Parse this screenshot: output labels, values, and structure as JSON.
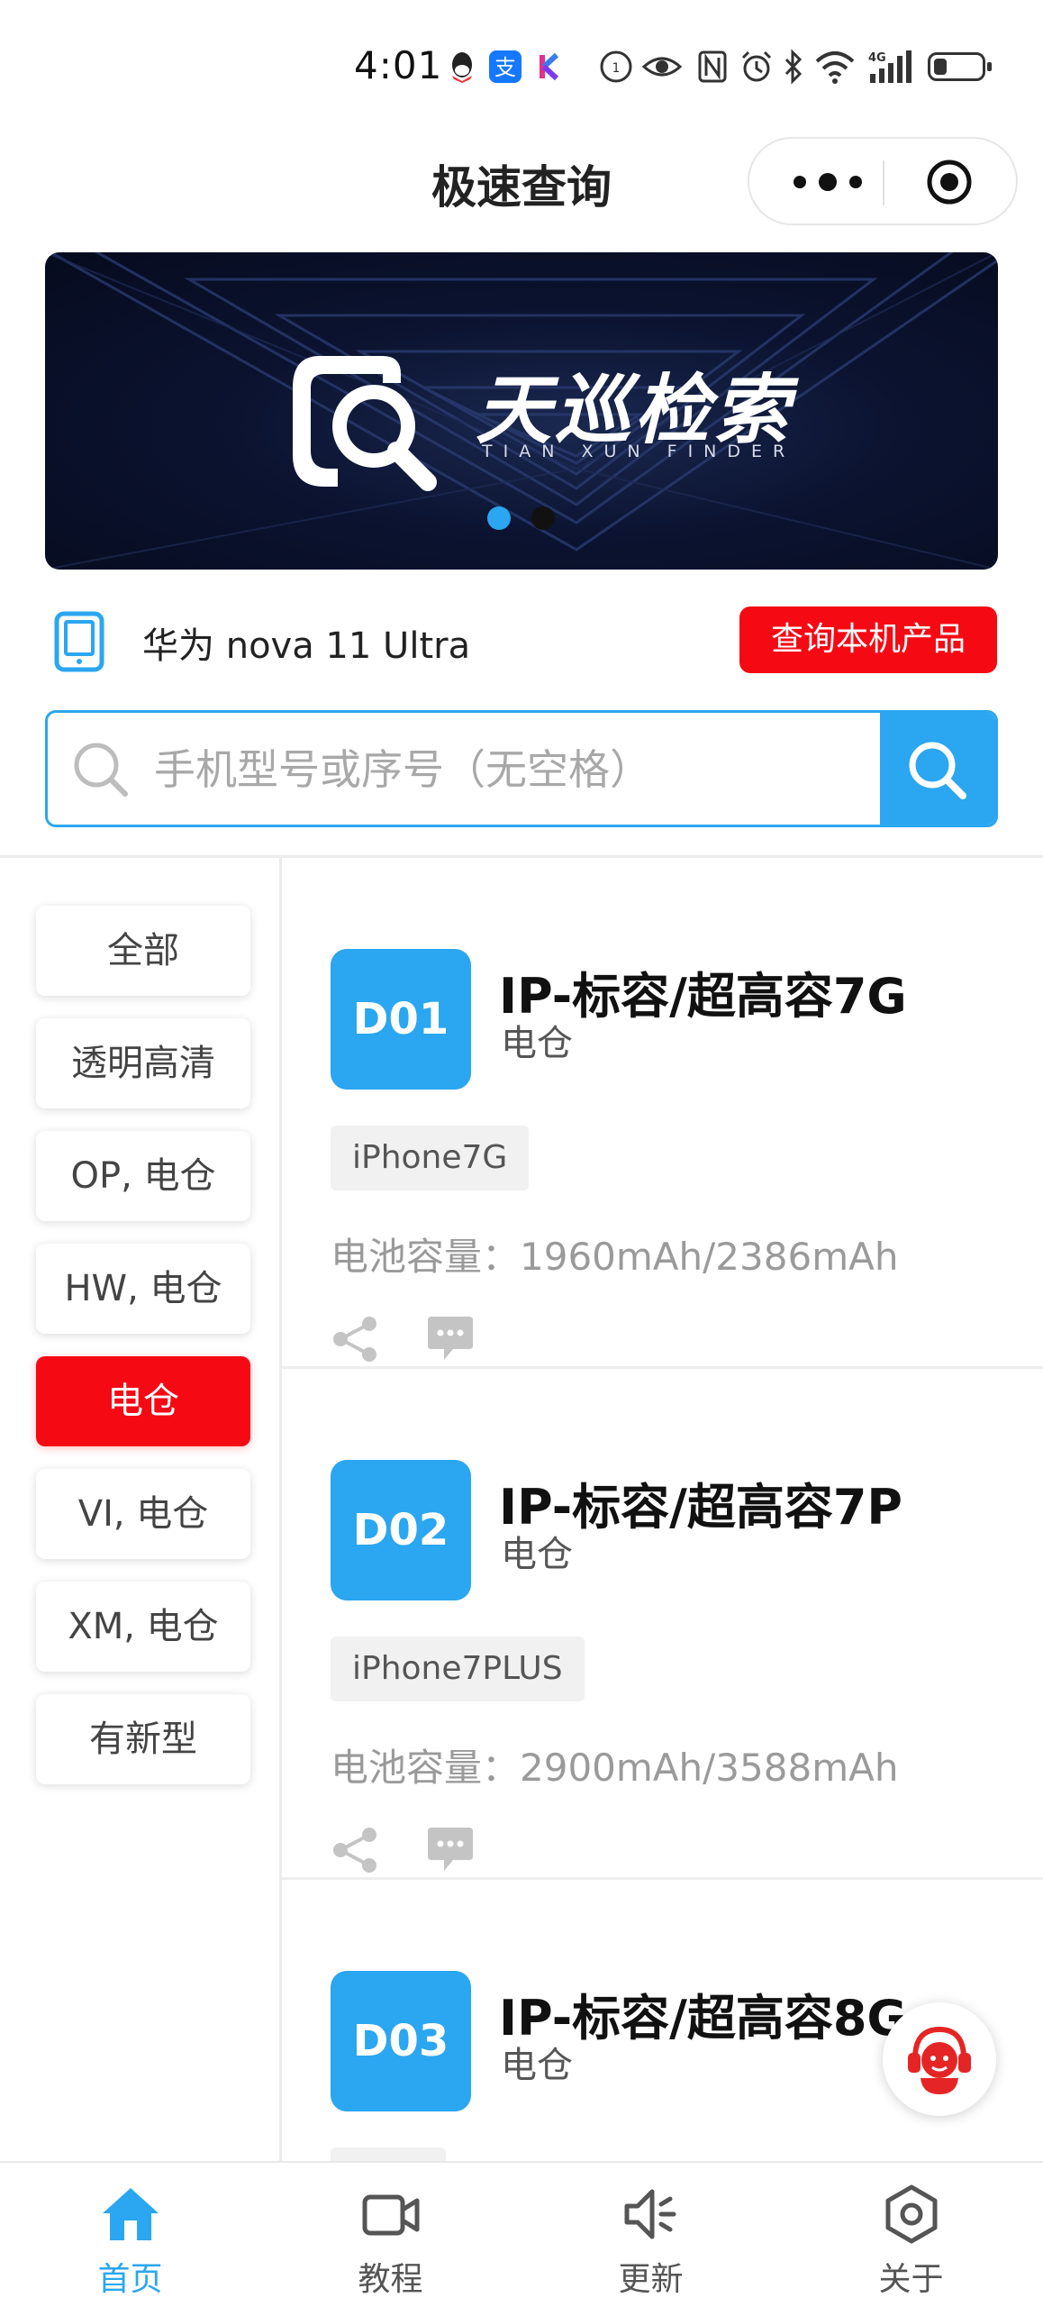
{
  "status_bar": {
    "time": "4:01",
    "network": "4G"
  },
  "header": {
    "title": "极速查询",
    "menu_icon": "more-dots-icon",
    "close_icon": "target-circle-icon"
  },
  "banner": {
    "title": "天巡检索",
    "subtitle": "TIAN XUN FINDER",
    "active_dot": 0,
    "dot_count": 2,
    "dot_colors": [
      "#2ba6f0",
      "#111111"
    ]
  },
  "device": {
    "name": "华为 nova 11 Ultra",
    "query_label": "查询本机产品"
  },
  "search": {
    "placeholder": "手机型号或序号（无空格）",
    "value": ""
  },
  "categories": [
    {
      "label": "全部",
      "active": false
    },
    {
      "label": "透明高清",
      "active": false
    },
    {
      "label": "OP, 电仓",
      "active": false
    },
    {
      "label": "HW, 电仓",
      "active": false
    },
    {
      "label": "电仓",
      "active": true
    },
    {
      "label": "VI, 电仓",
      "active": false
    },
    {
      "label": "XM, 电仓",
      "active": false
    },
    {
      "label": "有新型",
      "active": false
    }
  ],
  "products": [
    {
      "code": "D01",
      "name": "IP-标容/超高容7G",
      "type": "电仓",
      "tag": "iPhone7G",
      "capacity": "电池容量：1960mAh/2386mAh"
    },
    {
      "code": "D02",
      "name": "IP-标容/超高容7P",
      "type": "电仓",
      "tag": "iPhone7PLUS",
      "capacity": "电池容量：2900mAh/3588mAh"
    },
    {
      "code": "D03",
      "name": "IP-标容/超高容8G",
      "type": "电仓",
      "tag": "",
      "capacity": ""
    }
  ],
  "tabbar": {
    "items": [
      {
        "label": "首页",
        "icon": "home-icon",
        "active": true
      },
      {
        "label": "教程",
        "icon": "video-camera-icon",
        "active": false
      },
      {
        "label": "更新",
        "icon": "speaker-icon",
        "active": false
      },
      {
        "label": "关于",
        "icon": "hexagon-settings-icon",
        "active": false
      }
    ]
  },
  "colors": {
    "accent_blue": "#2ba6f0",
    "accent_red": "#f50a14"
  }
}
